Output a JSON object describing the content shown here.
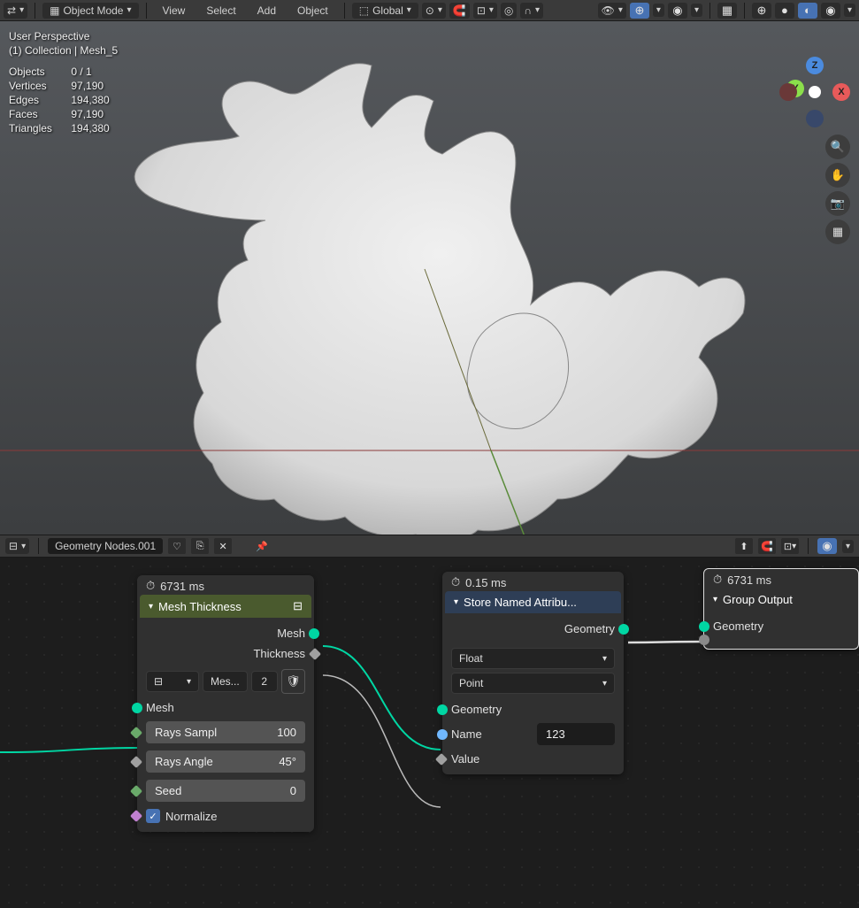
{
  "header": {
    "mode": "Object Mode",
    "orientation": "Global",
    "menus": [
      "View",
      "Select",
      "Add",
      "Object"
    ]
  },
  "viewport": {
    "perspective": "User Perspective",
    "collection": "(1) Collection | Mesh_5",
    "stats": {
      "objects_label": "Objects",
      "objects": "0 / 1",
      "vertices_label": "Vertices",
      "vertices": "97,190",
      "edges_label": "Edges",
      "edges": "194,380",
      "faces_label": "Faces",
      "faces": "97,190",
      "triangles_label": "Triangles",
      "triangles": "194,380"
    },
    "axes": {
      "x": "X",
      "y": "Y",
      "z": "Z"
    }
  },
  "node_editor": {
    "tree_name": "Geometry Nodes.001"
  },
  "nodes": {
    "thickness": {
      "time": "6731 ms",
      "title": "Mesh Thickness",
      "out_mesh": "Mesh",
      "out_thickness": "Thickness",
      "mesh_sel": "Mes...",
      "mesh_count": "2",
      "in_mesh": "Mesh",
      "rays_sampl_label": "Rays Sampl",
      "rays_sampl_val": "100",
      "rays_angle_label": "Rays Angle",
      "rays_angle_val": "45°",
      "seed_label": "Seed",
      "seed_val": "0",
      "normalize": "Normalize"
    },
    "store": {
      "time": "0.15 ms",
      "title": "Store Named Attribu...",
      "out_geometry": "Geometry",
      "data_type": "Float",
      "domain": "Point",
      "in_geometry": "Geometry",
      "in_name_label": "Name",
      "in_name_val": "123",
      "in_value": "Value"
    },
    "output": {
      "time": "6731 ms",
      "title": "Group Output",
      "in_geometry": "Geometry"
    }
  }
}
